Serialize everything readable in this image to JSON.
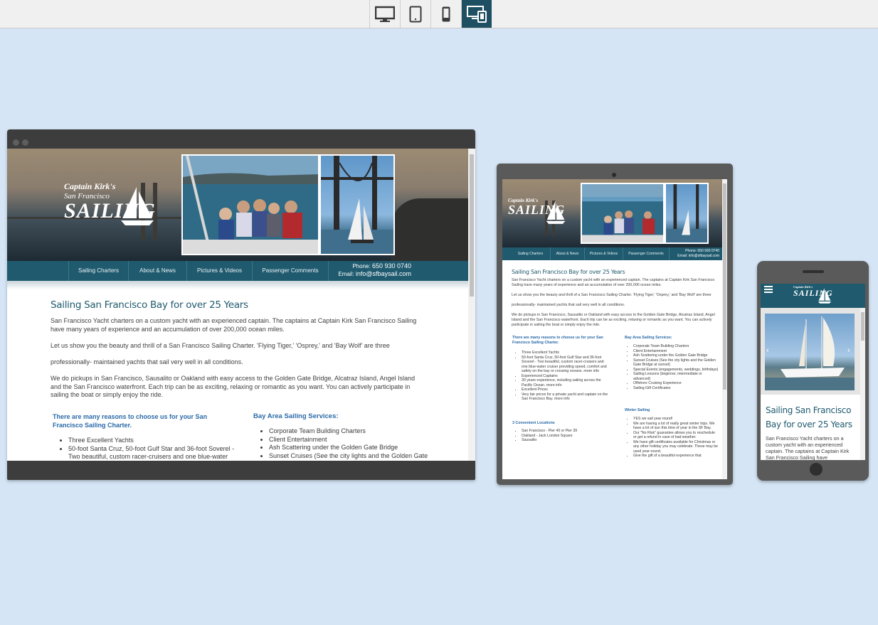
{
  "toolbar": {
    "buttons": [
      {
        "name": "desktop-view-button",
        "icon": "desktop-icon",
        "active": false
      },
      {
        "name": "tablet-view-button",
        "icon": "tablet-icon",
        "active": false
      },
      {
        "name": "mobile-view-button",
        "icon": "mobile-icon",
        "active": false
      },
      {
        "name": "responsive-view-button",
        "icon": "responsive-devices-icon",
        "active": true
      }
    ]
  },
  "site": {
    "logo_top": "Captain Kirk's",
    "logo_mid": "San Francisco",
    "logo_main": "SAILING",
    "nav": [
      "Sailing Charters",
      "About & News",
      "Pictures & Videos",
      "Passenger Comments"
    ],
    "phone_label": "Phone:",
    "phone": "650 930 0740",
    "email_label": "Email:",
    "email": "info@sfbaysail.com",
    "heading": "Sailing San Francisco Bay for over 25 Years",
    "p1": "San Francisco Yacht charters on a custom yacht with an experienced captain. The captains at Captain Kirk San Francisco Sailing have many years of experience and an accumulation of over 200,000 ocean miles.",
    "p2a": "Let us show you the beauty and thrill of a San Francisco Sailing Charter. 'Flying Tiger,' 'Osprey,' and 'Bay Wolf' are three",
    "p2b": "professionally- maintained yachts that sail very well in all conditions.",
    "p3": "We do pickups in San Francisco, Sausalito or Oakland with easy access to the Golden Gate Bridge, Alcatraz Island, Angel Island and the San Francisco waterfront. Each trip can be as exciting, relaxing or romantic as you want. You can actively participate in sailing the boat or simply enjoy the ride.",
    "reasons_title": "There are many reasons to choose us for your San Francisco Sailing Charter.",
    "reasons": [
      "Three Excellent Yachts",
      "50-foot Santa Cruz, 50-foot Gulf Star and 36-foot Soverel - Two beautiful, custom racer-cruisers and one blue-water cruiser providing speed, comfort and safety on the bay or crossing oceans. more info",
      "Experienced Captains",
      "30 years experience, including sailing across the Pacific Ocean. more info",
      "Excellent Prices",
      "Very fair prices for a private yacht and captain on the San Francisco Bay. more info"
    ],
    "services_title": "Bay Area Sailing Services:",
    "services": [
      "Corporate Team Building Charters",
      "Client Entertainment",
      "Ash Scattering under the Golden Gate Bridge",
      "Sunset Cruises (See the city lights and the Golden Gate Bridge at sunset)",
      "Special Events (engagements, weddings, birthdays)",
      "Sailing Lessons (beginner, intermediate or advanced)",
      "Offshore Cruising Experience",
      "Sailing Gift Certificates"
    ],
    "locations_title": "3 Convenient Locations",
    "locations": [
      "San Francisco - Pier 40 or Pier 39",
      "Oakland - Jack London Square",
      "Sausalito"
    ],
    "winter_title": "Winter Sailing",
    "winter": [
      "YES we sail year round!",
      "We are having a lot of really great winter trips. We have a lot of sun this time of year in the SF Bay.",
      "Our \"No Risk\" guarantee allows you to reschedule or get a refund in case of bad weather.",
      "We have gift certificates available for Christmas or any other holiday you may celebrate. These may be used year-round.",
      "Give the gift of a beautiful experience that"
    ],
    "mobile_heading": "Sailing San Francisco Bay for over 25 Years",
    "mobile_p1": "San Francisco Yacht charters on a custom yacht with an experienced captain. The captains at Captain Kirk San Francisco Sailing have"
  },
  "colors": {
    "page_bg": "#d5e5f5",
    "nav_bg": "#1f5a6e",
    "heading": "#1f5a6e",
    "subheading": "#2a6aa8",
    "device_frame": "#3d3d3d",
    "toolbar_active": "#1f4f63"
  }
}
